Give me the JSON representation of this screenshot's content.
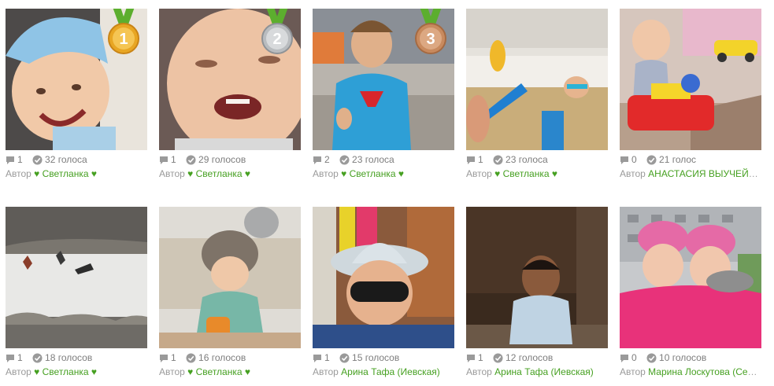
{
  "photos": [
    {
      "comments": "1",
      "votes": "32 голоса",
      "author_label": "Автор",
      "author_name": "♥ Светланка ♥",
      "medal": "1",
      "photo_desc": "smiling baby in blue hat"
    },
    {
      "comments": "1",
      "votes": "29 голосов",
      "author_label": "Автор",
      "author_name": "♥ Светланка ♥",
      "medal": "2",
      "photo_desc": "laughing baby close-up"
    },
    {
      "comments": "2",
      "votes": "23 голоса",
      "author_label": "Автор",
      "author_name": "♥ Светланка ♥",
      "medal": "3",
      "photo_desc": "boy in superman shirt thumbs up"
    },
    {
      "comments": "1",
      "votes": "23 голоса",
      "author_label": "Автор",
      "author_name": "♥ Светланка ♥",
      "medal": "",
      "photo_desc": "child with goggles in bathtub"
    },
    {
      "comments": "0",
      "votes": "21 голос",
      "author_label": "Автор",
      "author_name": "АНАСТАСИЯ ВЫУЧЕЙСКАЯ",
      "medal": "",
      "photo_desc": "toddler on toy car"
    },
    {
      "comments": "1",
      "votes": "18 голосов",
      "author_label": "Автор",
      "author_name": "♥ Светланка ♥",
      "medal": "",
      "photo_desc": "people on snowy slope"
    },
    {
      "comments": "1",
      "votes": "16 голосов",
      "author_label": "Автор",
      "author_name": "♥ Светланка ♥",
      "medal": "",
      "photo_desc": "baby in fur hat with cup"
    },
    {
      "comments": "1",
      "votes": "15 голосов",
      "author_label": "Автор",
      "author_name": "Арина Тафа (Иевская)",
      "medal": "",
      "photo_desc": "child in hat and sunglasses"
    },
    {
      "comments": "1",
      "votes": "12 голосов",
      "author_label": "Автор",
      "author_name": "Арина Тафа (Иевская)",
      "medal": "",
      "photo_desc": "baby sitting on floor"
    },
    {
      "comments": "0",
      "votes": "10 голосов",
      "author_label": "Автор",
      "author_name": "Марина Лоскутова (Семенова)",
      "medal": "",
      "photo_desc": "two girls in pink jackets"
    }
  ],
  "colors": {
    "link": "#46a021",
    "gold": "#e8a623",
    "silver": "#b9bcbf",
    "bronze": "#c88a5e",
    "ribbon": "#5cae2e"
  },
  "icons": {
    "comments": "speech-bubble-icon",
    "votes": "check-circle-icon"
  }
}
